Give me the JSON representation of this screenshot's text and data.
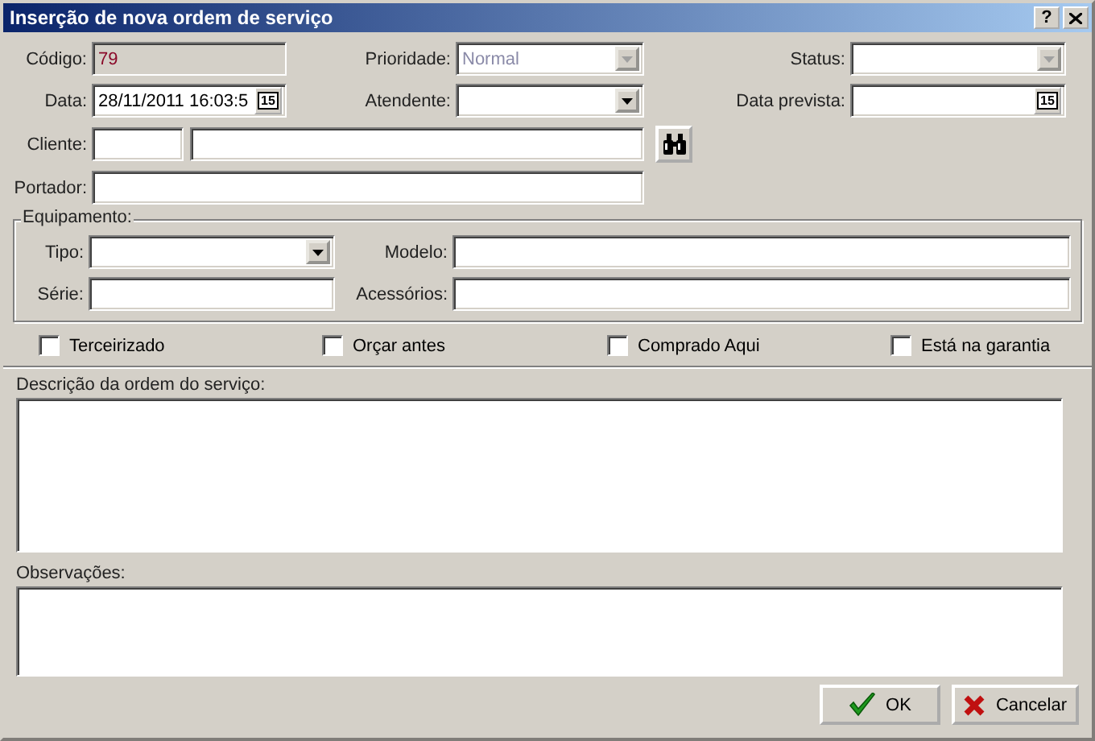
{
  "window": {
    "title": "Inserção de nova ordem de serviço",
    "help_button": "?"
  },
  "codigo": {
    "label": "Código:",
    "value": "79",
    "read_only": true
  },
  "prioridade": {
    "label": "Prioridade:",
    "value": "Normal",
    "disabled": true
  },
  "status": {
    "label": "Status:",
    "disabled": true
  },
  "data": {
    "label": "Data:",
    "value": "28/11/2011 16:03:5",
    "calendar": "15"
  },
  "atendente": {
    "label": "Atendente:",
    "disabled": false
  },
  "data_prevista": {
    "label": "Data prevista:",
    "calendar": "15"
  },
  "cliente": {
    "label": "Cliente:"
  },
  "portador": {
    "label": "Portador:"
  },
  "equipamento": {
    "title": "Equipamento:",
    "tipo": {
      "label": "Tipo:",
      "disabled": false
    },
    "modelo": {
      "label": "Modelo:"
    },
    "serie": {
      "label": "Série:"
    },
    "acessorios": {
      "label": "Acessórios:"
    }
  },
  "checkboxes": [
    {
      "label": "Terceirizado",
      "checked": false
    },
    {
      "label": "Orçar antes",
      "checked": false
    },
    {
      "label": "Comprado Aqui",
      "checked": false
    },
    {
      "label": "Está na garantia",
      "checked": false
    }
  ],
  "descricao": {
    "label": "Descrição da ordem do serviço:"
  },
  "observacoes": {
    "label": "Observações:"
  },
  "buttons": [
    {
      "label": "OK",
      "kind": "ok"
    },
    {
      "label": "Cancelar",
      "kind": "cancel"
    }
  ]
}
